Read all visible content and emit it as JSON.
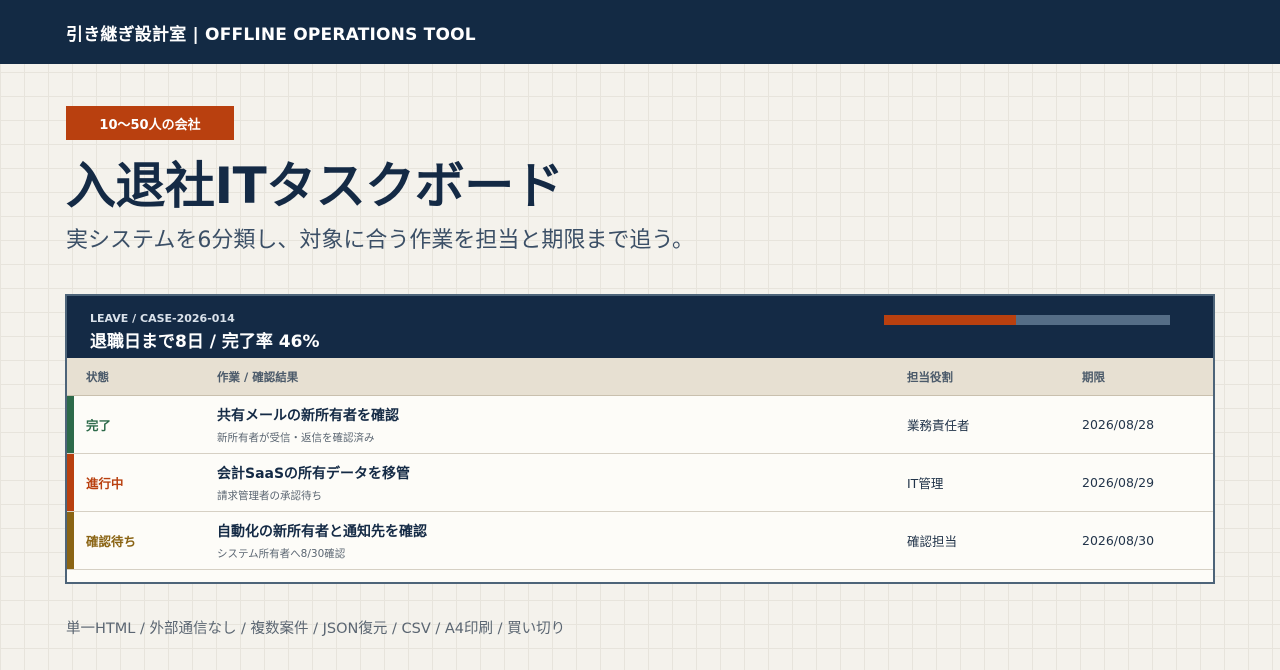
{
  "header": {
    "brand": "引き継ぎ設計室 | OFFLINE OPERATIONS TOOL"
  },
  "hero": {
    "badge": "10〜50人の会社",
    "title": "入退社ITタスクボード",
    "subtitle": "実システムを6分類し、対象に合う作業を担当と期限まで追う。"
  },
  "board": {
    "case_id": "LEAVE / CASE-2026-014",
    "summary": "退職日まで8日 / 完了率 46%",
    "progress_fraction": 0.46,
    "colors": {
      "progress_fill": "#b9400f",
      "progress_track": "#556d86"
    },
    "columns": {
      "status": "状態",
      "task": "作業 / 確認結果",
      "role": "担当役割",
      "due": "期限"
    },
    "rows": [
      {
        "status": "完了",
        "status_color": "#2d6a4a",
        "title": "共有メールの新所有者を確認",
        "note": "新所有者が受信・返信を確認済み",
        "role": "業務責任者",
        "due": "2026/08/28"
      },
      {
        "status": "進行中",
        "status_color": "#b9400f",
        "title": "会計SaaSの所有データを移管",
        "note": "請求管理者の承認待ち",
        "role": "IT管理",
        "due": "2026/08/29"
      },
      {
        "status": "確認待ち",
        "status_color": "#8a6414",
        "title": "自動化の新所有者と通知先を確認",
        "note": "システム所有者へ8/30確認",
        "role": "確認担当",
        "due": "2026/08/30"
      }
    ]
  },
  "footer": {
    "features": "単一HTML / 外部通信なし / 複数案件 / JSON復元 / CSV / A4印刷 / 買い切り"
  }
}
